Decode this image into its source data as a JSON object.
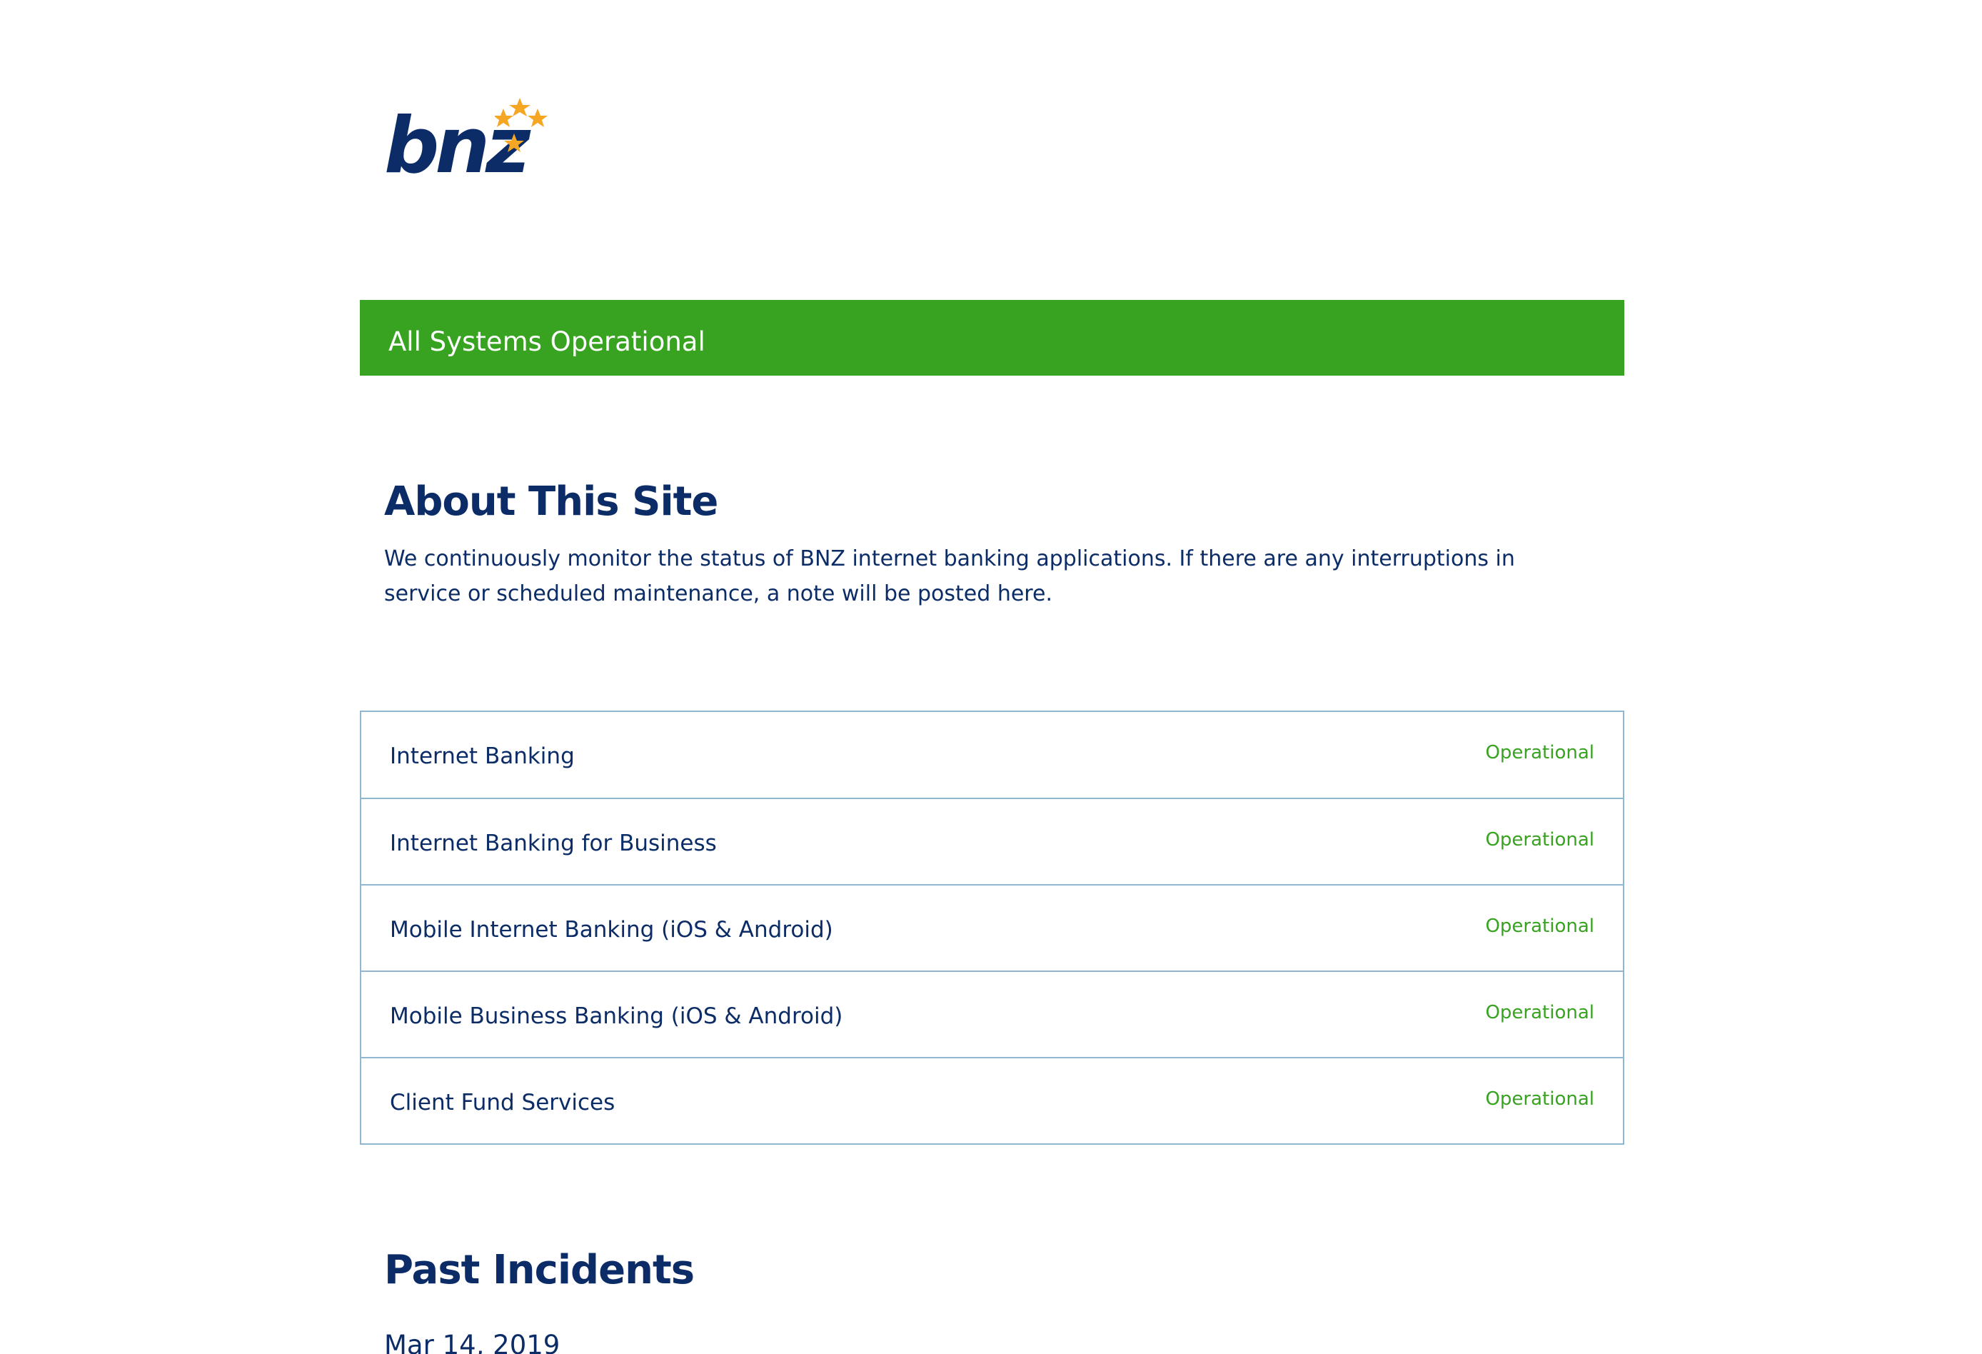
{
  "brand": {
    "logo_text": "bnz",
    "primary_color": "#0b2c66",
    "accent_color": "#f5a623",
    "status_color": "#38a320"
  },
  "status_banner": {
    "text": "All Systems Operational"
  },
  "about": {
    "title": "About This Site",
    "text": "We continuously monitor the status of BNZ internet banking applications. If there are any interruptions in service or scheduled maintenance, a note will be posted here."
  },
  "components": [
    {
      "name": "Internet Banking",
      "status": "Operational"
    },
    {
      "name": "Internet Banking for Business",
      "status": "Operational"
    },
    {
      "name": "Mobile Internet Banking (iOS & Android)",
      "status": "Operational"
    },
    {
      "name": "Mobile Business Banking (iOS & Android)",
      "status": "Operational"
    },
    {
      "name": "Client Fund Services",
      "status": "Operational"
    }
  ],
  "incidents": {
    "title": "Past Incidents",
    "first_date": "Mar 14, 2019"
  }
}
